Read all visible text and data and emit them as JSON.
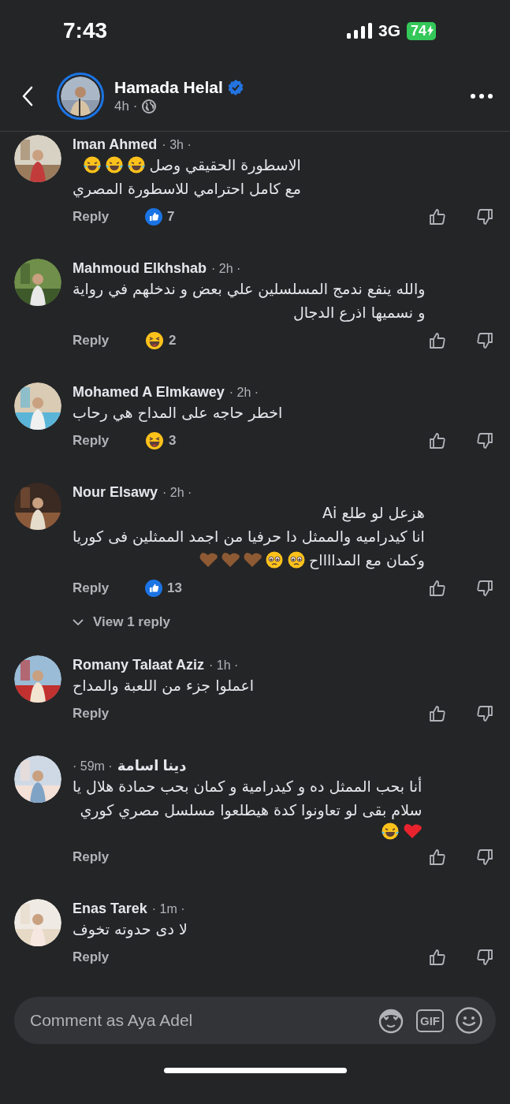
{
  "status_bar": {
    "time": "7:43",
    "network": "3G",
    "battery": "74"
  },
  "post_header": {
    "author": "Hamada Helal",
    "verified": true,
    "time": "4h ·"
  },
  "comments": [
    {
      "name": "Iman Ahmed",
      "time": "· 3h ·",
      "lines": [
        {
          "text": "الاسطورة الحقيقي وصل",
          "emojis": [
            {
              "kind": "tears-of-joy"
            },
            {
              "kind": "tears-of-joy"
            },
            {
              "kind": "tears-of-joy"
            }
          ]
        },
        {
          "text": "مع كامل احترامي للاسطورة المصري"
        }
      ],
      "reply_label": "Reply",
      "reaction": {
        "kind": "like",
        "count": "7"
      }
    },
    {
      "name": "Mahmoud Elkhshab",
      "time": "· 2h ·",
      "lines": [
        {
          "text": "والله ينفع ندمج المسلسلين علي بعض و ندخلهم في رواية"
        },
        {
          "text": "و نسميها اذرع الدجال"
        }
      ],
      "reply_label": "Reply",
      "reaction": {
        "kind": "haha",
        "count": "2"
      }
    },
    {
      "name": "Mohamed A Elmkawey",
      "time": "· 2h ·",
      "lines": [
        {
          "text": "اخطر حاجه على المداح هي رحاب"
        }
      ],
      "reply_label": "Reply",
      "reaction": {
        "kind": "haha",
        "count": "3"
      }
    },
    {
      "name": "Nour Elsawy",
      "time": "· 2h ·",
      "lines": [
        {
          "text": "هزعل لو طلع Ai"
        },
        {
          "text": "انا كيدراميه والممثل دا حرفيا من اجمد الممثلين فى كوريا"
        },
        {
          "text": "وكمان مع المدااااح",
          "emojis": [
            {
              "kind": "pleading"
            },
            {
              "kind": "pleading"
            },
            {
              "kind": "brown-heart"
            },
            {
              "kind": "brown-heart"
            },
            {
              "kind": "brown-heart"
            }
          ]
        }
      ],
      "reply_label": "Reply",
      "reaction": {
        "kind": "like",
        "count": "13"
      },
      "view_replies": "View 1 reply"
    },
    {
      "name": "Romany Talaat Aziz",
      "time": "· 1h ·",
      "lines": [
        {
          "text": "اعملوا جزء من اللعبة والمداح"
        }
      ],
      "reply_label": "Reply"
    },
    {
      "name": "دينا  اسامة",
      "time": "· 59m ·",
      "lines": [
        {
          "text": "أنا بحب الممثل ده و كيدرامية و كمان بحب حمادة هلال يا"
        },
        {
          "text": "سلام بقى لو تعاونوا كدة هيطلعوا مسلسل مصري كوري"
        },
        {
          "emojis": [
            {
              "kind": "red-heart"
            },
            {
              "kind": "tears-of-joy"
            }
          ]
        }
      ],
      "reply_label": "Reply"
    },
    {
      "name": "Enas Tarek",
      "time": "· 1m ·",
      "lines": [
        {
          "text": "لا دى حدوته تخوف"
        }
      ],
      "reply_label": "Reply"
    }
  ],
  "composer": {
    "placeholder": "Comment as Aya Adel",
    "gif_label": "GIF"
  }
}
